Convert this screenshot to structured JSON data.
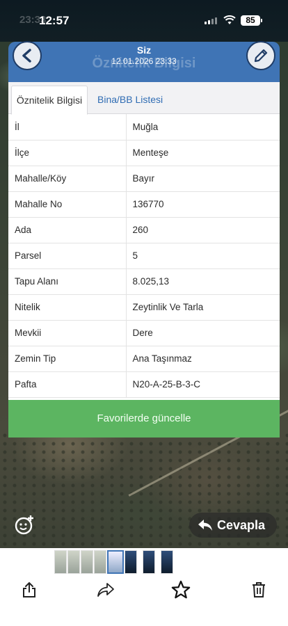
{
  "status_bar": {
    "time": "12:57",
    "ghost_time": "23:33",
    "battery": "85"
  },
  "header": {
    "sender": "Siz",
    "date": "12.01.2026 23:33",
    "ghost_title": "Öznitelik Bilgisi",
    "color": "#3f74b5"
  },
  "tabs": [
    {
      "label": "Öznitelik Bilgisi",
      "active": true
    },
    {
      "label": "Bina/BB Listesi",
      "active": false
    }
  ],
  "attributes": [
    {
      "key": "İl",
      "value": "Muğla"
    },
    {
      "key": "İlçe",
      "value": "Menteşe"
    },
    {
      "key": "Mahalle/Köy",
      "value": "Bayır"
    },
    {
      "key": "Mahalle No",
      "value": "136770"
    },
    {
      "key": "Ada",
      "value": "260"
    },
    {
      "key": "Parsel",
      "value": "5"
    },
    {
      "key": "Tapu Alanı",
      "value": "8.025,13"
    },
    {
      "key": "Nitelik",
      "value": "Zeytinlik Ve Tarla"
    },
    {
      "key": "Mevkii",
      "value": "Dere"
    },
    {
      "key": "Zemin Tip",
      "value": "Ana Taşınmaz"
    },
    {
      "key": "Pafta",
      "value": "N20-A-25-B-3-C"
    }
  ],
  "favorite_button": {
    "label": "Favorilerde güncelle",
    "color": "#5cb561"
  },
  "reply_button": {
    "label": "Cevapla"
  },
  "toolbar": {
    "icons": [
      "share-icon",
      "forward-icon",
      "star-icon",
      "trash-icon"
    ]
  }
}
